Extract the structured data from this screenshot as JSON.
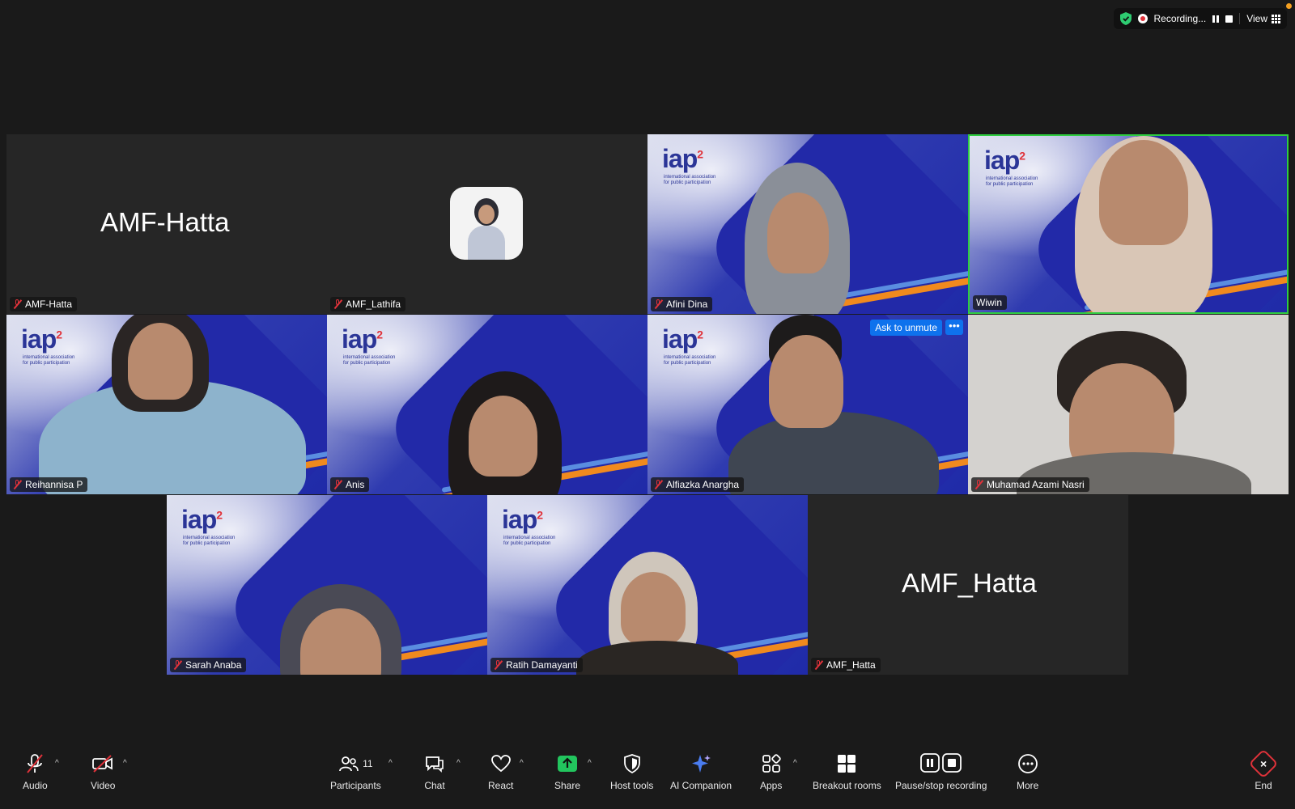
{
  "top_bar": {
    "recording_label": "Recording...",
    "view_label": "View"
  },
  "tiles": {
    "t1": {
      "name": "AMF-Hatta",
      "display_name": "AMF-Hatta"
    },
    "t2": {
      "name": "AMF_Lathifa"
    },
    "t3": {
      "name": "Afini Dina"
    },
    "t4": {
      "name": "Wiwin"
    },
    "t5": {
      "name": "Reihannisa P"
    },
    "t6": {
      "name": "Anis"
    },
    "t7": {
      "name": "Alfiazka Anargha",
      "ask_unmute": "Ask to unmute",
      "more": "•••"
    },
    "t8": {
      "name": "Muhamad Azami Nasri"
    },
    "t9": {
      "name": "Sarah Anaba"
    },
    "t10": {
      "name": "Ratih Damayanti"
    },
    "t11": {
      "name": "AMF_Hatta",
      "display_name": "AMF_Hatta"
    }
  },
  "logo": {
    "text": "iap",
    "sup": "2",
    "sub": "international association for public participation"
  },
  "toolbar": {
    "audio": "Audio",
    "video": "Video",
    "participants": "Participants",
    "participants_count": "11",
    "chat": "Chat",
    "react": "React",
    "share": "Share",
    "host_tools": "Host tools",
    "ai_companion": "AI Companion",
    "apps": "Apps",
    "breakout_rooms": "Breakout rooms",
    "pause_stop_recording": "Pause/stop recording",
    "more": "More",
    "end": "End"
  },
  "colors": {
    "accent_blue": "#0e72ed",
    "active_speaker": "#2ecc40",
    "muted_red": "#e0323a",
    "share_green": "#22c55e"
  }
}
